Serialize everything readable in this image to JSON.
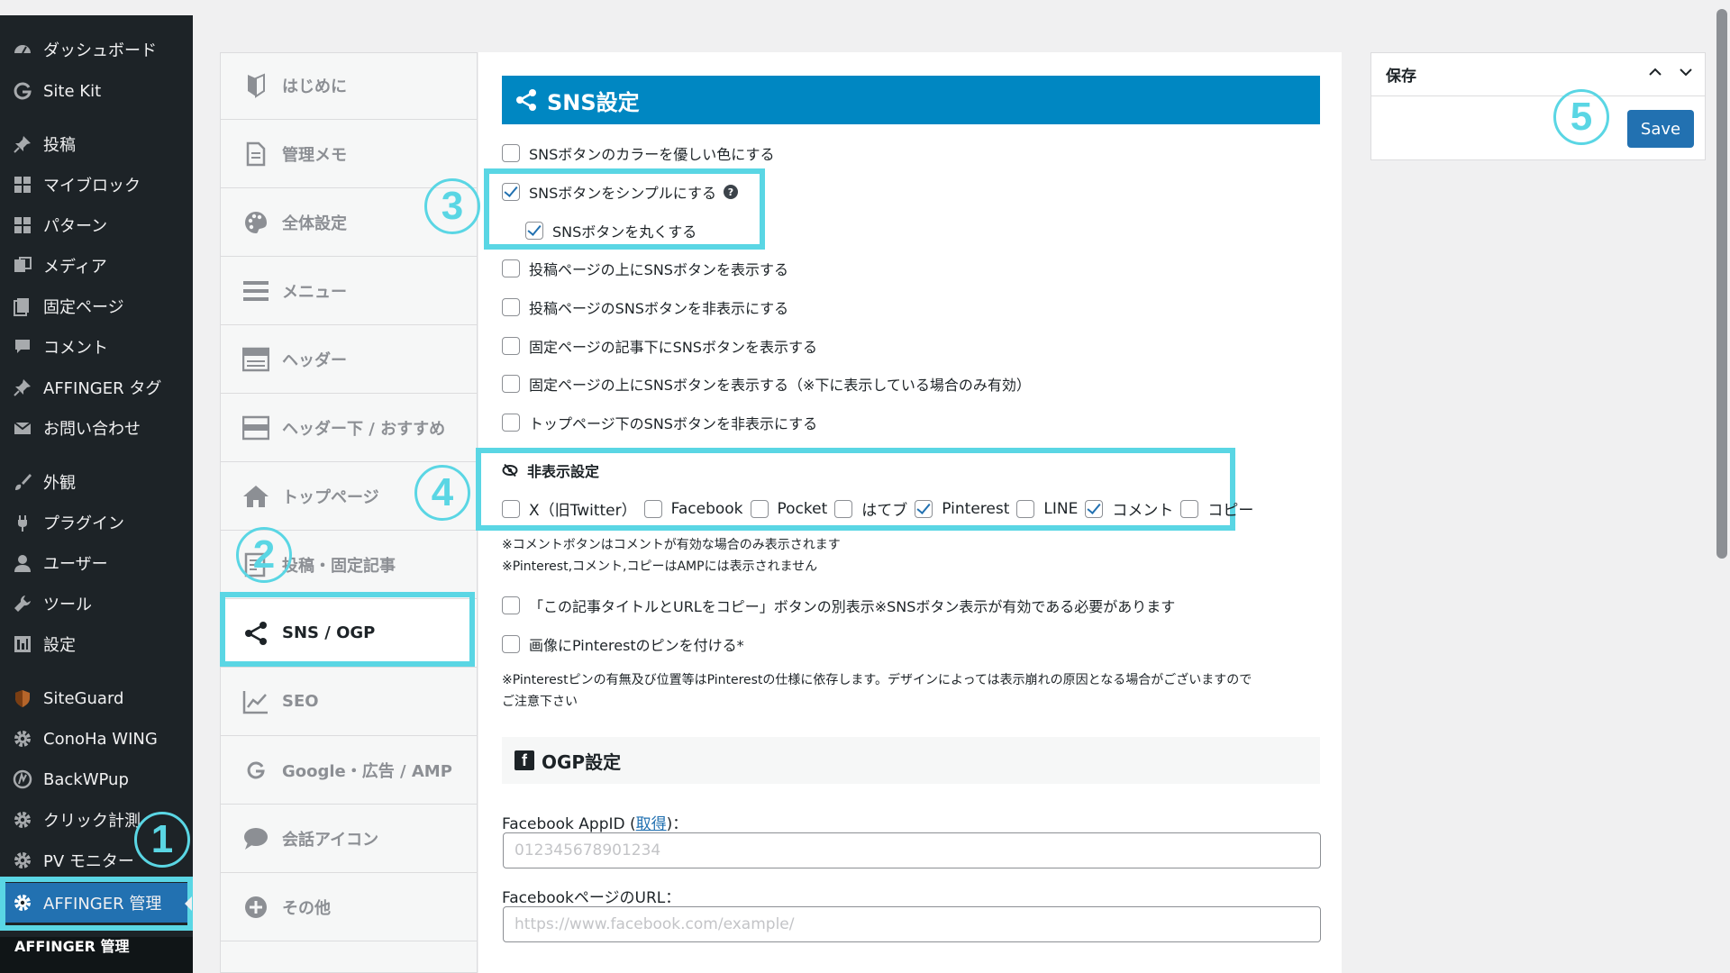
{
  "admin_menu": {
    "items": [
      {
        "label": "ダッシュボード",
        "icon": "dashboard-icon"
      },
      {
        "label": "Site Kit",
        "icon": "google-g-icon"
      },
      {
        "label": "投稿",
        "icon": "pin-icon"
      },
      {
        "label": "マイブロック",
        "icon": "blocks-icon"
      },
      {
        "label": "パターン",
        "icon": "blocks-icon"
      },
      {
        "label": "メディア",
        "icon": "media-icon"
      },
      {
        "label": "固定ページ",
        "icon": "page-icon"
      },
      {
        "label": "コメント",
        "icon": "comment-icon"
      },
      {
        "label": "AFFINGER タグ",
        "icon": "pin-icon"
      },
      {
        "label": "お問い合わせ",
        "icon": "mail-icon"
      },
      {
        "label": "外観",
        "icon": "brush-icon"
      },
      {
        "label": "プラグイン",
        "icon": "plugin-icon"
      },
      {
        "label": "ユーザー",
        "icon": "user-icon"
      },
      {
        "label": "ツール",
        "icon": "wrench-icon"
      },
      {
        "label": "設定",
        "icon": "settings-icon"
      },
      {
        "label": "SiteGuard",
        "icon": "shield-icon"
      },
      {
        "label": "ConoHa WING",
        "icon": "gear-icon"
      },
      {
        "label": "BackWPup",
        "icon": "backup-icon"
      },
      {
        "label": "クリック計測",
        "icon": "gear-icon"
      },
      {
        "label": "PV モニター",
        "icon": "gear-icon"
      },
      {
        "label": "AFFINGER 管理",
        "icon": "gear-icon"
      }
    ],
    "submenu_label": "AFFINGER 管理"
  },
  "settings_nav": {
    "items": [
      {
        "label": "はじめに",
        "icon": "beginner-icon"
      },
      {
        "label": "管理メモ",
        "icon": "memo-icon"
      },
      {
        "label": "全体設定",
        "icon": "palette-icon"
      },
      {
        "label": "メニュー",
        "icon": "menu-icon"
      },
      {
        "label": "ヘッダー",
        "icon": "header-icon"
      },
      {
        "label": "ヘッダー下 / おすすめ",
        "icon": "header-below-icon"
      },
      {
        "label": "トップページ",
        "icon": "home-icon"
      },
      {
        "label": "投稿・固定記事",
        "icon": "post-icon"
      },
      {
        "label": "SNS / OGP",
        "icon": "share-icon"
      },
      {
        "label": "SEO",
        "icon": "chart-icon"
      },
      {
        "label": "Google・広告 / AMP",
        "icon": "google-g-icon"
      },
      {
        "label": "会話アイコン",
        "icon": "speech-icon"
      },
      {
        "label": "その他",
        "icon": "plus-circle-icon"
      }
    ]
  },
  "sns": {
    "title": "SNS設定",
    "options": [
      {
        "label": "SNSボタンのカラーを優しい色にする",
        "checked": false
      },
      {
        "label": "SNSボタンをシンプルにする",
        "checked": true
      },
      {
        "label": "SNSボタンを丸くする",
        "checked": true
      },
      {
        "label": "投稿ページの上にSNSボタンを表示する",
        "checked": false
      },
      {
        "label": "投稿ページのSNSボタンを非表示にする",
        "checked": false
      },
      {
        "label": "固定ページの記事下にSNSボタンを表示する",
        "checked": false
      },
      {
        "label": "固定ページの上にSNSボタンを表示する（※下に表示している場合のみ有効）",
        "checked": false
      },
      {
        "label": "トップページ下のSNSボタンを非表示にする",
        "checked": false
      }
    ],
    "help_glyph": "?",
    "hidden_title": "非表示設定",
    "hidden_items": [
      {
        "label": "X（旧Twitter）",
        "checked": false
      },
      {
        "label": "Facebook",
        "checked": false
      },
      {
        "label": "Pocket",
        "checked": false
      },
      {
        "label": "はてブ",
        "checked": false
      },
      {
        "label": "Pinterest",
        "checked": true
      },
      {
        "label": "LINE",
        "checked": false
      },
      {
        "label": "コメント",
        "checked": true
      },
      {
        "label": "コピー",
        "checked": false
      }
    ],
    "note1": "※コメントボタンはコメントが有効な場合のみ表示されます",
    "note2": "※Pinterest,コメント,コピーはAMPには表示されません",
    "copy_option": {
      "label": "「この記事タイトルとURLをコピー」ボタンの別表示※SNSボタン表示が有効である必要があります",
      "checked": false
    },
    "pin_option": {
      "label": "画像にPinterestのピンを付ける*",
      "checked": false
    },
    "note3": "※Pinterestピンの有無及び位置等はPinterestの仕様に依存します。デザインによっては表示崩れの原因となる場合がございますので",
    "note4": "ご注意下さい"
  },
  "ogp": {
    "title": "OGP設定",
    "fb_icon_glyph": "f",
    "appid_label_pre": "Facebook AppID (",
    "appid_link": "取得",
    "appid_label_post": ")：",
    "appid_placeholder": "012345678901234",
    "appid_value": "",
    "page_url_label": "FacebookページのURL：",
    "page_url_placeholder": "https://www.facebook.com/example/",
    "page_url_value": ""
  },
  "save_box": {
    "title": "保存",
    "button_label": "Save"
  },
  "badges": [
    "1",
    "2",
    "3",
    "4",
    "5"
  ],
  "colors": {
    "highlight": "#5ad6e4",
    "header_blue": "#0087c2",
    "primary": "#2271b1",
    "sidebar_bg": "#1d2327"
  }
}
